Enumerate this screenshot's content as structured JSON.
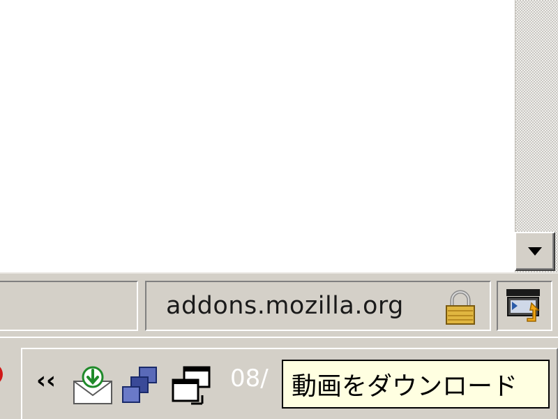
{
  "statusbar": {
    "url": "addons.mozilla.org",
    "lock_icon": "lock-icon",
    "extension_icon": "video-download-icon"
  },
  "toolbar": {
    "collapse_label": "‹‹",
    "icons": [
      "orb-icon",
      "mail-download-icon",
      "network-icon",
      "windows-icon"
    ],
    "date_text": "08/"
  },
  "tooltip": {
    "text": "動画をダウンロード"
  },
  "colors": {
    "chrome": "#d4d0c8",
    "tooltip_bg": "#ffffe1",
    "content_bg": "#ffffff"
  }
}
